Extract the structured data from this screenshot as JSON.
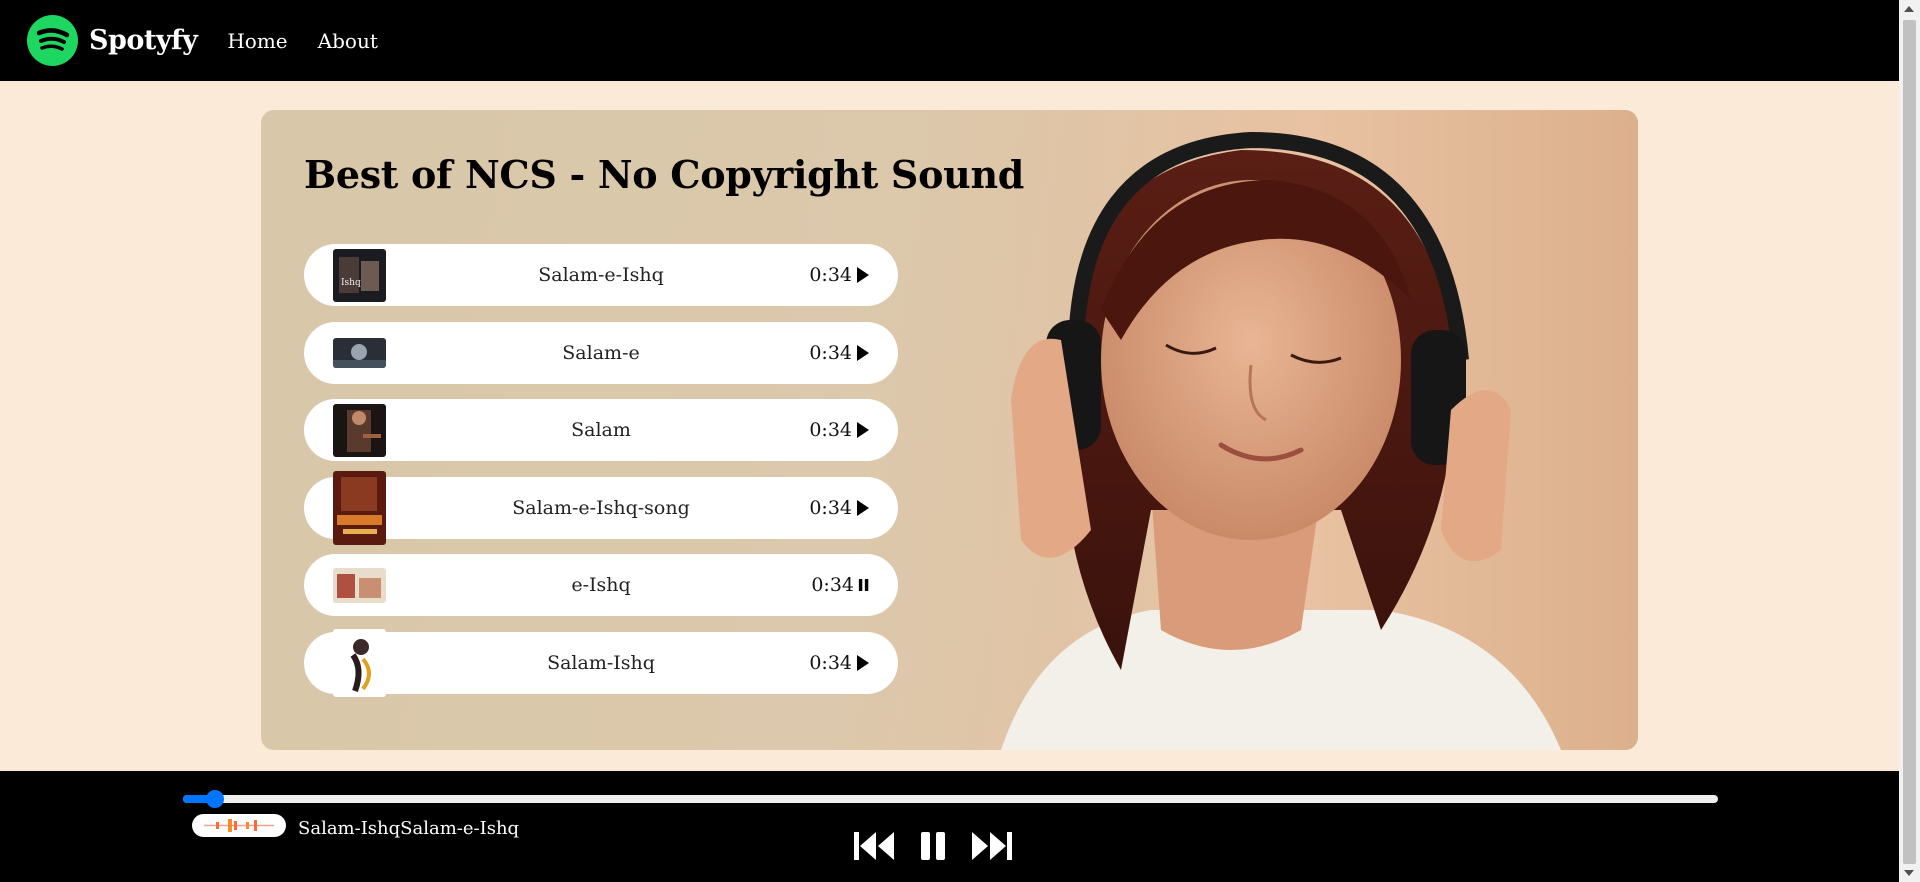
{
  "nav": {
    "brand": "Spotyfy",
    "links": [
      "Home",
      "About"
    ]
  },
  "playlist": {
    "title": "Best of NCS - No Copyright Sound",
    "songs": [
      {
        "name": "Salam-e-Ishq",
        "duration": "0:34",
        "state": "play"
      },
      {
        "name": "Salam-e",
        "duration": "0:34",
        "state": "play"
      },
      {
        "name": "Salam",
        "duration": "0:34",
        "state": "play"
      },
      {
        "name": "Salam-e-Ishq-song",
        "duration": "0:34",
        "state": "play"
      },
      {
        "name": "e-Ishq",
        "duration": "0:34",
        "state": "pause"
      },
      {
        "name": "Salam-Ishq",
        "duration": "0:34",
        "state": "play"
      }
    ]
  },
  "player": {
    "now_playing": "Salam-IshqSalam-e-Ishq",
    "progress_fraction": 0.015,
    "controls": [
      "previous",
      "pause",
      "next"
    ]
  },
  "colors": {
    "brand_green": "#1ed760",
    "accent_blue": "#0075ff",
    "page_bg": "#fbead8",
    "bar_bg": "#000000"
  }
}
